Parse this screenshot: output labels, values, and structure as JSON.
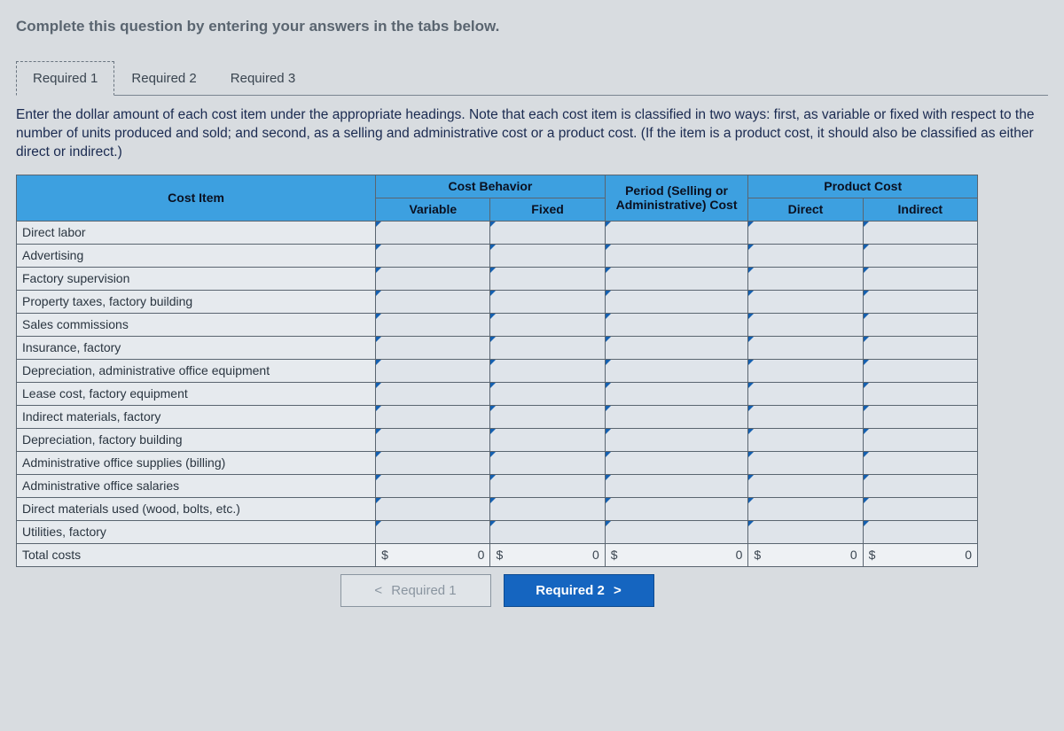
{
  "instruction_top": "Complete this question by entering your answers in the tabs below.",
  "tabs": [
    "Required 1",
    "Required 2",
    "Required 3"
  ],
  "active_tab_index": 0,
  "prompt": "Enter the dollar amount of each cost item under the appropriate headings. Note that each cost item is classified in two ways: first, as variable or fixed with respect to the number of units produced and sold; and second, as a selling and administrative cost or a product cost. (If the item is a product cost, it should also be classified as either direct or indirect.)",
  "headers": {
    "cost_item": "Cost Item",
    "cost_behavior": "Cost Behavior",
    "variable": "Variable",
    "fixed": "Fixed",
    "period": "Period (Selling or Administrative) Cost",
    "product_cost": "Product Cost",
    "direct": "Direct",
    "indirect": "Indirect"
  },
  "rows": [
    "Direct labor",
    "Advertising",
    "Factory supervision",
    "Property taxes, factory building",
    "Sales commissions",
    "Insurance, factory",
    "Depreciation, administrative office equipment",
    "Lease cost, factory equipment",
    "Indirect materials, factory",
    "Depreciation, factory building",
    "Administrative office supplies (billing)",
    "Administrative office salaries",
    "Direct materials used (wood, bolts, etc.)",
    "Utilities, factory"
  ],
  "totals": {
    "label": "Total costs",
    "currency": "$",
    "variable": "0",
    "fixed": "0",
    "period": "0",
    "direct": "0",
    "indirect": "0"
  },
  "nav": {
    "prev": "Required 1",
    "next": "Required 2"
  },
  "chev_left": "<",
  "chev_right": ">"
}
